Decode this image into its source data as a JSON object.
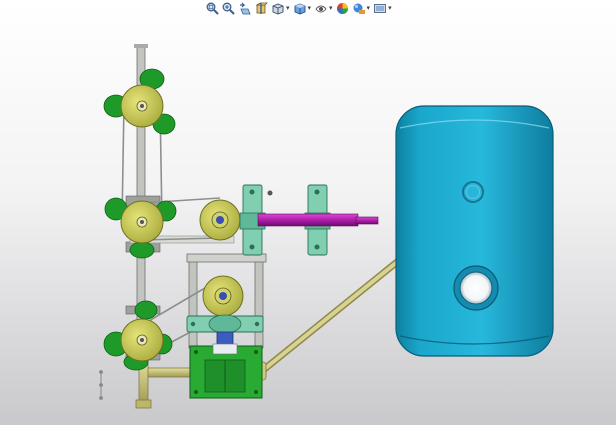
{
  "toolbar": {
    "items": [
      {
        "name": "zoom-to-fit-icon",
        "dropdown": false
      },
      {
        "name": "zoom-to-area-icon",
        "dropdown": false
      },
      {
        "name": "previous-view-icon",
        "dropdown": false
      },
      {
        "name": "section-view-icon",
        "dropdown": false
      },
      {
        "name": "view-orientation-icon",
        "dropdown": true
      },
      {
        "name": "display-style-icon",
        "dropdown": true
      },
      {
        "name": "hide-show-items-icon",
        "dropdown": true
      },
      {
        "name": "edit-appearance-icon",
        "dropdown": false
      },
      {
        "name": "apply-scene-icon",
        "dropdown": true
      },
      {
        "name": "view-settings-icon",
        "dropdown": true
      }
    ],
    "caret": "▾"
  },
  "colors": {
    "tank": "#19a3c4",
    "tank_dark": "#0c6f8e",
    "pulley": "#c7c750",
    "leaf": "#1f9a2a",
    "frame": "#b7b9b3",
    "bearing": "#6cc3a0",
    "shaft": "#b51fb1",
    "pipe": "#c8c27a",
    "motor": "#25a82d"
  }
}
